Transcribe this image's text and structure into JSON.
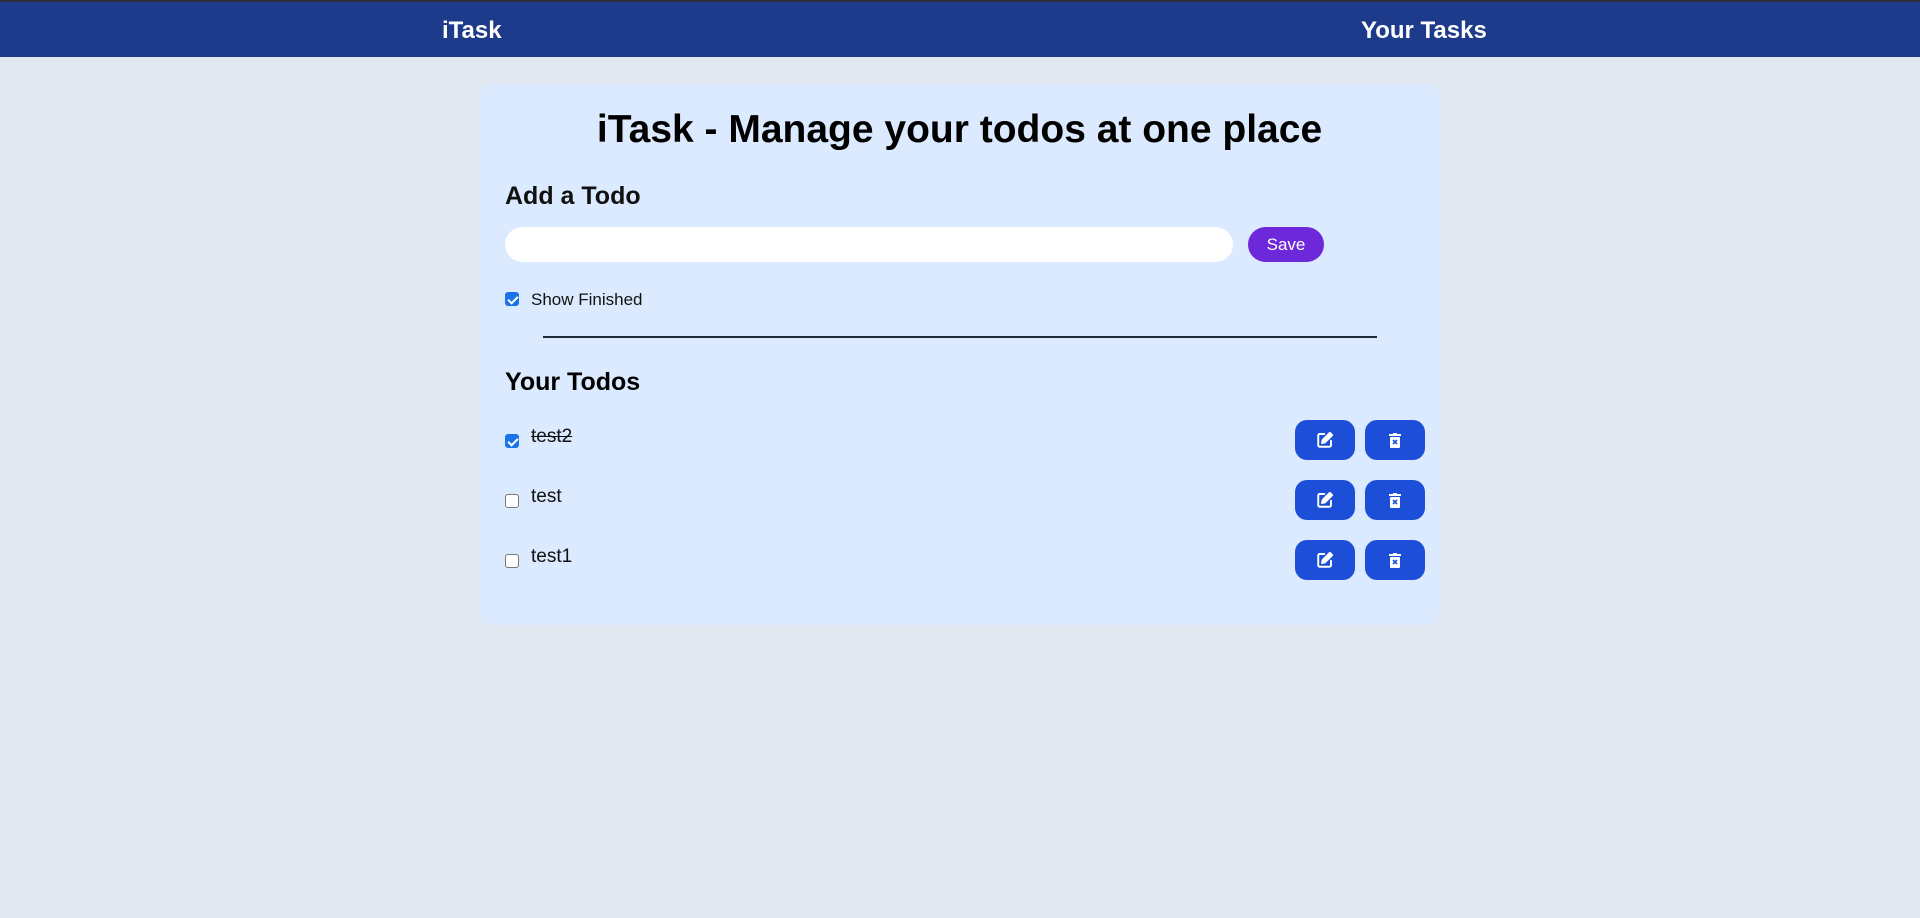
{
  "navbar": {
    "brand": "iTask",
    "link": "Your Tasks"
  },
  "main": {
    "title": "iTask - Manage your todos at one place",
    "add_heading": "Add a Todo",
    "input": {
      "value": "",
      "placeholder": ""
    },
    "save_label": "Save",
    "show_finished": {
      "label": "Show Finished",
      "checked": true
    },
    "todos_heading": "Your Todos",
    "todos": [
      {
        "text": "test2",
        "completed": true
      },
      {
        "text": "test",
        "completed": false
      },
      {
        "text": "test1",
        "completed": false
      }
    ]
  },
  "icons": {
    "edit": "edit-icon",
    "delete": "trash-icon"
  },
  "colors": {
    "navbar": "#1e3a8a",
    "page_background": "#e2e8f0",
    "card": "#dbeafe",
    "save_button": "#6d28d9",
    "action_button": "#1d4ed8",
    "checkbox_checked": "#1a73e8"
  }
}
